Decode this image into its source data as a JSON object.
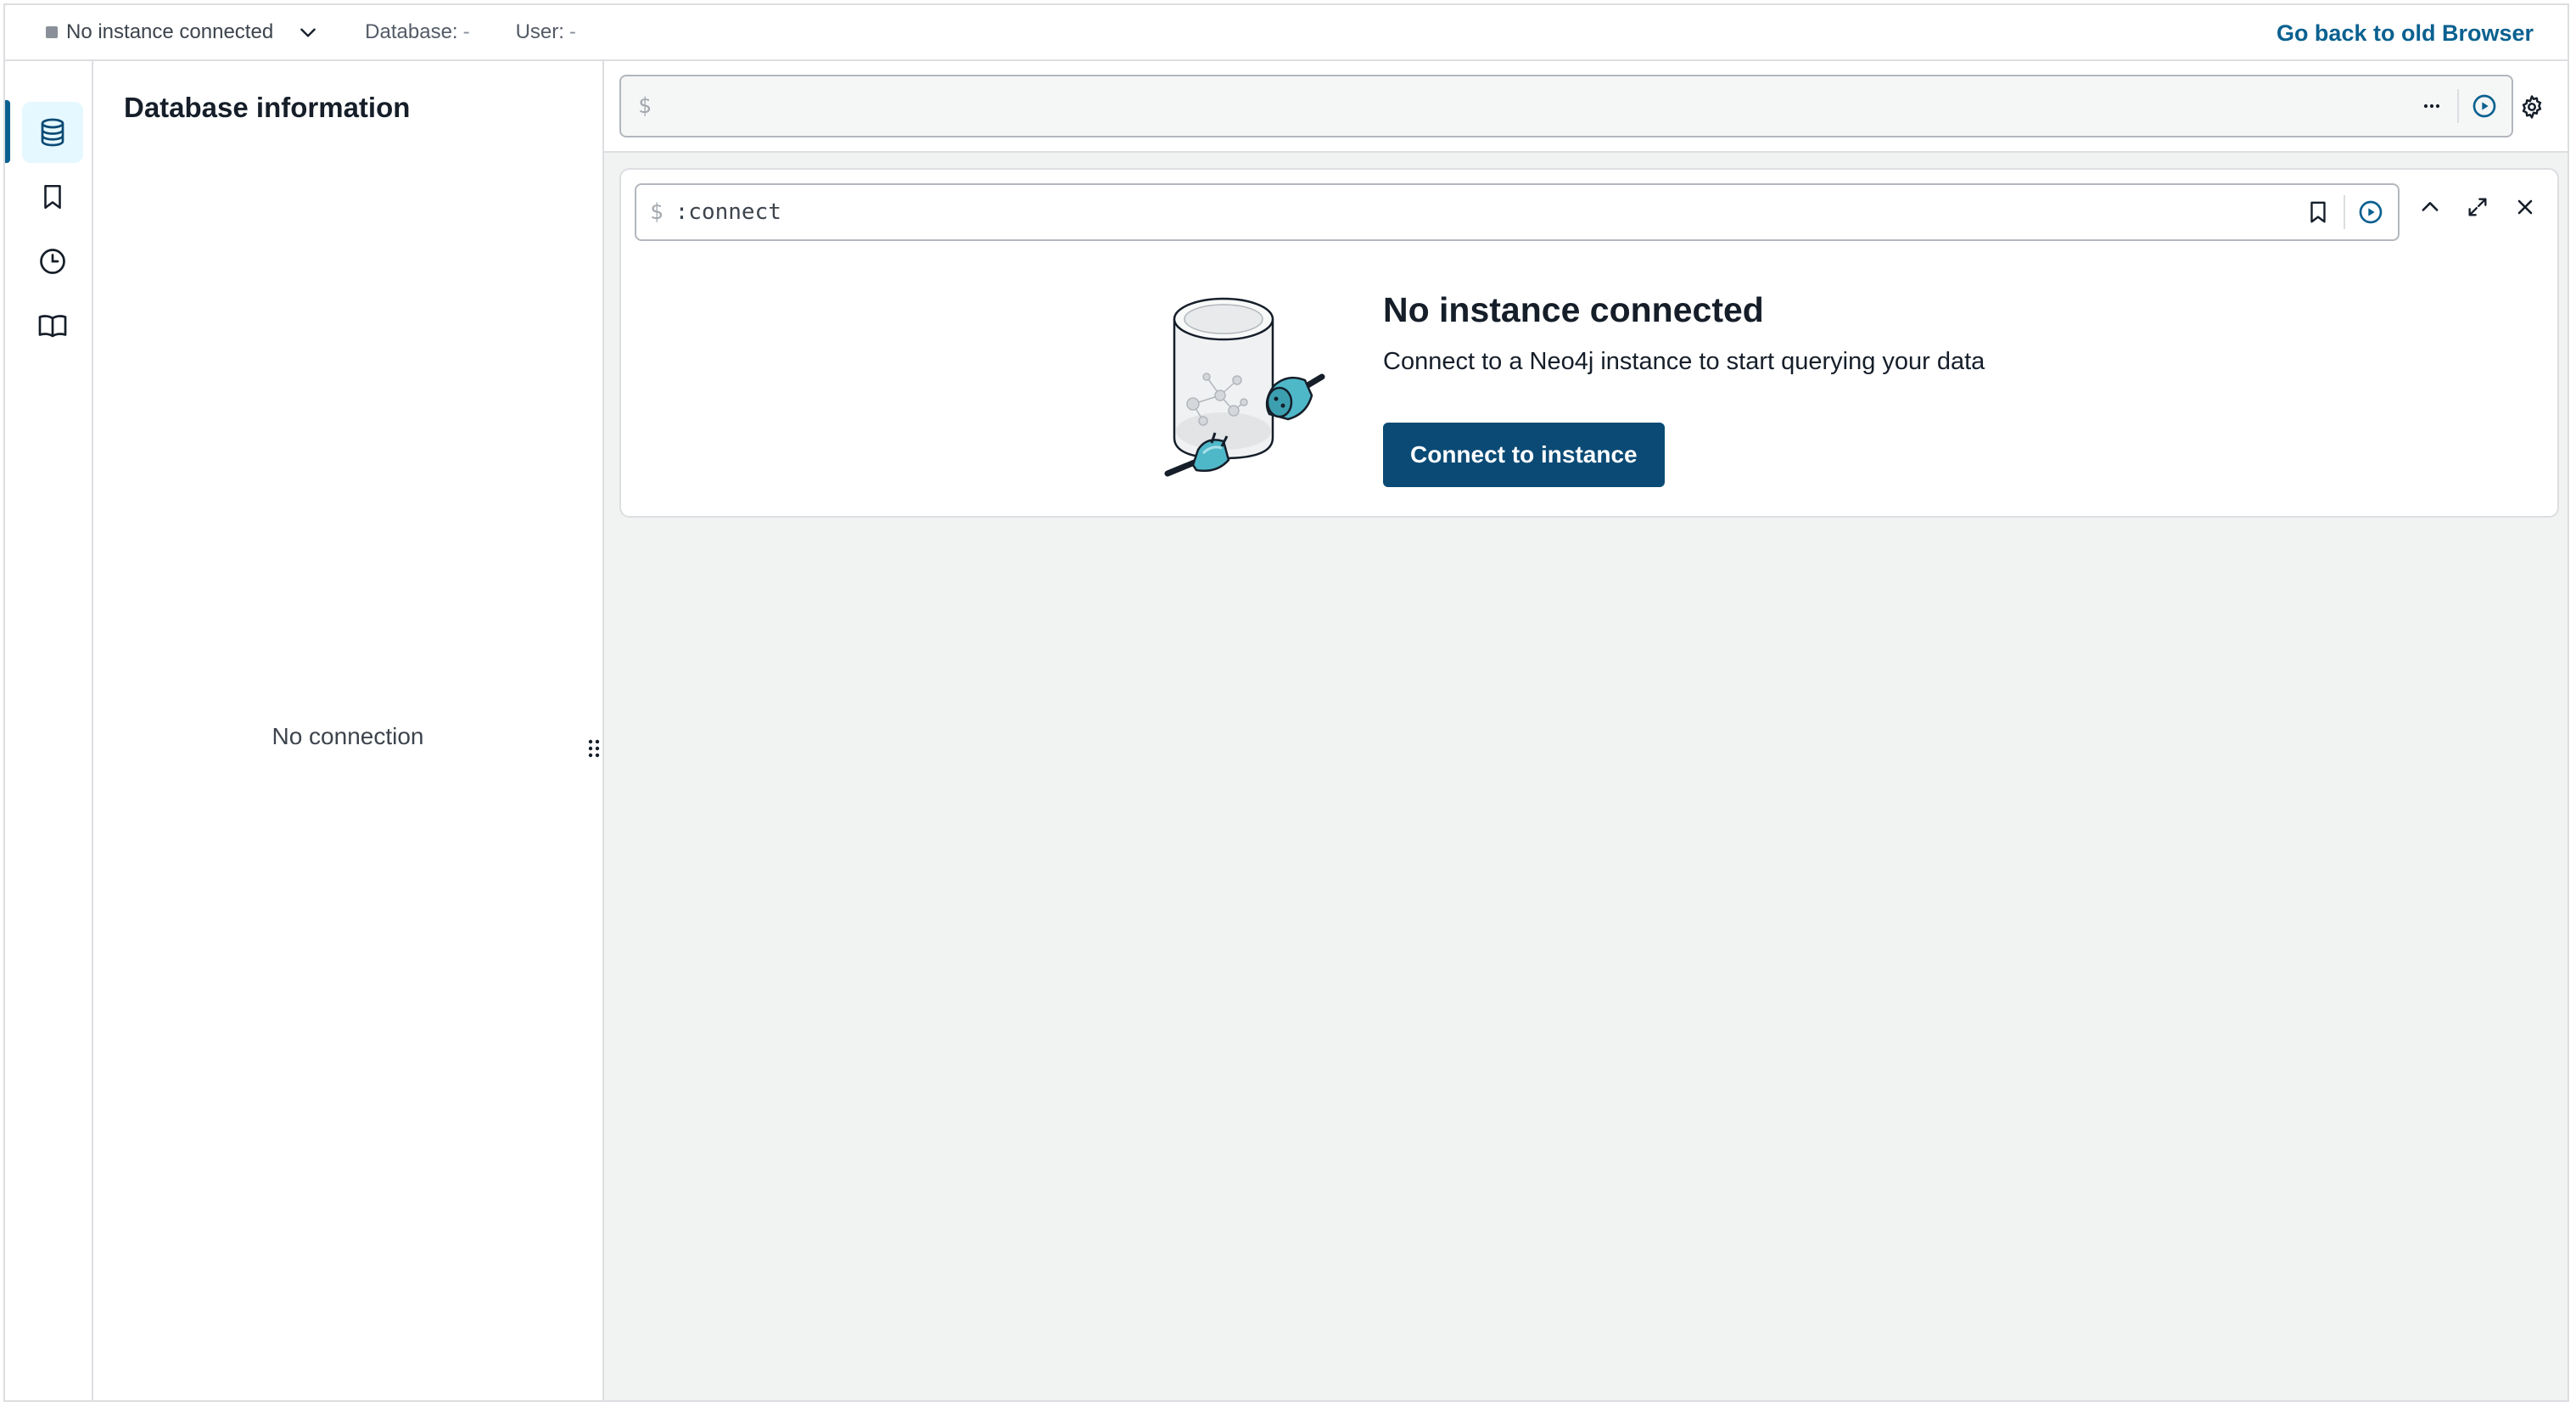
{
  "topbar": {
    "connection_status": "No instance connected",
    "database_label": "Database:",
    "database_value": "-",
    "user_label": "User:",
    "user_value": "-",
    "back_link": "Go back to old Browser"
  },
  "sidebar": {
    "active_item": "database-info",
    "items": [
      {
        "name": "database-info",
        "icon": "database-icon"
      },
      {
        "name": "favorites",
        "icon": "bookmark-icon"
      },
      {
        "name": "history",
        "icon": "clock-icon"
      },
      {
        "name": "guides",
        "icon": "book-icon"
      }
    ]
  },
  "db_panel": {
    "title": "Database information",
    "empty_text": "No connection"
  },
  "editor": {
    "prompt": "$",
    "value": "",
    "placeholder": ""
  },
  "frame": {
    "prompt": "$",
    "command": ":connect",
    "title": "No instance connected",
    "subtitle": "Connect to a Neo4j instance to start querying your data",
    "button_label": "Connect to instance"
  },
  "colors": {
    "accent": "#0a6190",
    "primary_button": "#0a4a75",
    "active_rail_bg": "#e6f8ff",
    "illustration_teal": "#4fb8c8"
  }
}
